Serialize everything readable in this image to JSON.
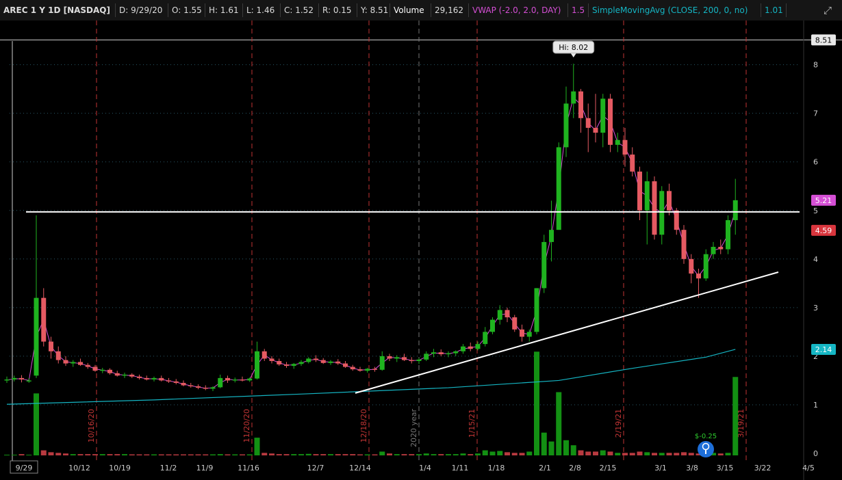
{
  "header": {
    "symbol": "AREC 1 Y 1D [NASDAQ]",
    "d": "D: 9/29/20",
    "o": "O: 1.55",
    "h": "H: 1.61",
    "l": "L: 1.46",
    "c": "C: 1.52",
    "r": "R: 0.15",
    "y": "Y: 8.51",
    "volume_label": "Volume",
    "volume_value": "29,162",
    "vwap_label": "VWAP (-2.0, 2.0, DAY)",
    "vwap_value": "1.5",
    "sma_label": "SimpleMovingAvg (CLOSE, 200, 0, no)",
    "sma_value": "1.01",
    "expand_icon": "expand-arrows-icon"
  },
  "colors": {
    "up": "#1fb31f",
    "down": "#e55a62",
    "vwap": "#d54fd5",
    "sma": "#15b6c4",
    "grid": "#2a5a6a",
    "event_line": "#c23535",
    "label_text": "#cccccc"
  },
  "price_axis": {
    "ticks": [
      "8",
      "7",
      "6",
      "5",
      "4",
      "3",
      "2",
      "1",
      "0"
    ],
    "badges": [
      {
        "text": "8.51",
        "value": 8.51,
        "bg": "#e8e8e8",
        "fg": "#000000"
      },
      {
        "text": "5.21",
        "value": 5.21,
        "bg": "#d54fd5",
        "fg": "#ffffff"
      },
      {
        "text": "4.59",
        "value": 4.59,
        "bg": "#d9363e",
        "fg": "#ffffff"
      },
      {
        "text": "2.14",
        "value": 2.14,
        "bg": "#15b6c4",
        "fg": "#ffffff"
      }
    ]
  },
  "time_axis": {
    "labels": [
      {
        "text": "9/29",
        "boxed": true
      },
      {
        "text": "10/12"
      },
      {
        "text": "10/19"
      },
      {
        "text": "11/2"
      },
      {
        "text": "11/9"
      },
      {
        "text": "11/16"
      },
      {
        "text": "12/7"
      },
      {
        "text": "12/14"
      },
      {
        "text": "1/4"
      },
      {
        "text": "1/11"
      },
      {
        "text": "1/18"
      },
      {
        "text": "2/1"
      },
      {
        "text": "2/8"
      },
      {
        "text": "2/15"
      },
      {
        "text": "3/1"
      },
      {
        "text": "3/8"
      },
      {
        "text": "3/15"
      },
      {
        "text": "3/22"
      },
      {
        "text": "4/5"
      }
    ]
  },
  "events": [
    "10/16/20",
    "11/20/20",
    "12/18/20",
    "1/15/21",
    "2/19/21",
    "3/19/21"
  ],
  "year_marker": "2020 year",
  "hi_callout": "Hi: 8.02",
  "dividend_label": "$-0.25",
  "dividend_icon": "dividend-bulb-icon",
  "annotations": {
    "resistance_level": 4.97,
    "trendline": [
      {
        "date": "12/10/20",
        "price": 1.24
      },
      {
        "date": "3/25/21",
        "price": 3.73
      }
    ]
  },
  "chart_data": {
    "type": "candlestick",
    "title": "AREC 1 Y 1D [NASDAQ]",
    "ylim": [
      0,
      8.51
    ],
    "candles": [
      [
        1.5,
        1.58,
        1.45,
        1.52
      ],
      [
        1.52,
        1.6,
        1.48,
        1.55
      ],
      [
        1.55,
        1.61,
        1.46,
        1.52
      ],
      [
        1.5,
        1.55,
        1.45,
        1.5
      ],
      [
        1.6,
        4.9,
        1.55,
        3.2
      ],
      [
        3.2,
        3.4,
        2.2,
        2.3
      ],
      [
        2.3,
        2.4,
        1.95,
        2.1
      ],
      [
        2.1,
        2.2,
        1.85,
        1.92
      ],
      [
        1.92,
        2.0,
        1.8,
        1.85
      ],
      [
        1.85,
        1.92,
        1.78,
        1.88
      ],
      [
        1.88,
        1.95,
        1.8,
        1.82
      ],
      [
        1.82,
        1.86,
        1.74,
        1.78
      ],
      [
        1.78,
        1.82,
        1.68,
        1.7
      ],
      [
        1.7,
        1.76,
        1.65,
        1.72
      ],
      [
        1.72,
        1.75,
        1.62,
        1.65
      ],
      [
        1.65,
        1.7,
        1.58,
        1.6
      ],
      [
        1.6,
        1.66,
        1.55,
        1.62
      ],
      [
        1.62,
        1.65,
        1.55,
        1.58
      ],
      [
        1.58,
        1.62,
        1.52,
        1.55
      ],
      [
        1.55,
        1.6,
        1.5,
        1.52
      ],
      [
        1.52,
        1.58,
        1.48,
        1.55
      ],
      [
        1.55,
        1.6,
        1.48,
        1.5
      ],
      [
        1.5,
        1.55,
        1.45,
        1.48
      ],
      [
        1.48,
        1.53,
        1.42,
        1.45
      ],
      [
        1.45,
        1.5,
        1.38,
        1.4
      ],
      [
        1.4,
        1.45,
        1.35,
        1.38
      ],
      [
        1.38,
        1.42,
        1.32,
        1.35
      ],
      [
        1.35,
        1.4,
        1.3,
        1.33
      ],
      [
        1.33,
        1.38,
        1.28,
        1.36
      ],
      [
        1.36,
        1.62,
        1.34,
        1.55
      ],
      [
        1.55,
        1.6,
        1.45,
        1.5
      ],
      [
        1.5,
        1.56,
        1.46,
        1.52
      ],
      [
        1.52,
        1.58,
        1.48,
        1.5
      ],
      [
        1.5,
        1.56,
        1.47,
        1.54
      ],
      [
        1.54,
        2.3,
        1.52,
        2.1
      ],
      [
        2.1,
        2.15,
        1.9,
        1.95
      ],
      [
        1.95,
        2.0,
        1.85,
        1.9
      ],
      [
        1.9,
        1.95,
        1.8,
        1.83
      ],
      [
        1.83,
        1.88,
        1.76,
        1.8
      ],
      [
        1.8,
        1.86,
        1.74,
        1.84
      ],
      [
        1.84,
        1.92,
        1.8,
        1.88
      ],
      [
        1.88,
        1.98,
        1.85,
        1.95
      ],
      [
        1.95,
        2.02,
        1.88,
        1.92
      ],
      [
        1.92,
        1.96,
        1.84,
        1.86
      ],
      [
        1.86,
        1.92,
        1.82,
        1.89
      ],
      [
        1.89,
        1.94,
        1.82,
        1.85
      ],
      [
        1.85,
        1.9,
        1.76,
        1.78
      ],
      [
        1.78,
        1.82,
        1.7,
        1.73
      ],
      [
        1.73,
        1.78,
        1.68,
        1.7
      ],
      [
        1.7,
        1.76,
        1.66,
        1.74
      ],
      [
        1.74,
        1.78,
        1.68,
        1.72
      ],
      [
        1.72,
        2.1,
        1.7,
        2.0
      ],
      [
        2.0,
        2.05,
        1.9,
        1.95
      ],
      [
        1.95,
        2.02,
        1.88,
        1.98
      ],
      [
        1.98,
        2.05,
        1.9,
        1.92
      ],
      [
        1.92,
        1.98,
        1.85,
        1.9
      ],
      [
        1.9,
        1.96,
        1.84,
        1.93
      ],
      [
        1.93,
        2.1,
        1.9,
        2.05
      ],
      [
        2.05,
        2.15,
        1.98,
        2.08
      ],
      [
        2.08,
        2.14,
        2.0,
        2.04
      ],
      [
        2.04,
        2.1,
        1.98,
        2.06
      ],
      [
        2.06,
        2.12,
        2.0,
        2.1
      ],
      [
        2.1,
        2.25,
        2.05,
        2.2
      ],
      [
        2.2,
        2.28,
        2.1,
        2.15
      ],
      [
        2.15,
        2.3,
        2.12,
        2.25
      ],
      [
        2.25,
        2.6,
        2.2,
        2.5
      ],
      [
        2.5,
        2.8,
        2.45,
        2.75
      ],
      [
        2.75,
        3.05,
        2.65,
        2.95
      ],
      [
        2.95,
        3.0,
        2.7,
        2.8
      ],
      [
        2.8,
        2.85,
        2.5,
        2.55
      ],
      [
        2.55,
        2.65,
        2.3,
        2.4
      ],
      [
        2.4,
        2.55,
        2.3,
        2.5
      ],
      [
        2.5,
        3.4,
        2.45,
        3.4
      ],
      [
        3.4,
        4.5,
        3.3,
        4.35
      ],
      [
        4.35,
        5.2,
        3.95,
        4.6
      ],
      [
        4.6,
        6.4,
        4.6,
        6.3
      ],
      [
        6.3,
        7.55,
        6.1,
        7.2
      ],
      [
        7.2,
        8.02,
        6.9,
        7.45
      ],
      [
        7.45,
        7.5,
        6.6,
        6.9
      ],
      [
        6.9,
        7.2,
        6.2,
        6.7
      ],
      [
        6.7,
        7.4,
        6.4,
        6.6
      ],
      [
        6.6,
        7.4,
        6.3,
        7.3
      ],
      [
        7.3,
        7.4,
        6.2,
        6.35
      ],
      [
        6.35,
        6.6,
        6.2,
        6.45
      ],
      [
        6.45,
        6.7,
        5.9,
        6.15
      ],
      [
        6.15,
        6.3,
        5.7,
        5.8
      ],
      [
        5.8,
        5.9,
        4.8,
        5.0
      ],
      [
        5.0,
        5.8,
        4.3,
        5.6
      ],
      [
        5.6,
        5.7,
        4.4,
        4.5
      ],
      [
        4.5,
        5.5,
        4.3,
        5.4
      ],
      [
        5.4,
        5.55,
        4.9,
        5.0
      ],
      [
        5.0,
        5.05,
        4.5,
        4.6
      ],
      [
        4.6,
        4.7,
        3.9,
        4.0
      ],
      [
        4.0,
        4.1,
        3.5,
        3.7
      ],
      [
        3.7,
        3.8,
        3.2,
        3.6
      ],
      [
        3.6,
        4.2,
        3.55,
        4.1
      ],
      [
        4.1,
        4.35,
        4.0,
        4.25
      ],
      [
        4.25,
        4.4,
        4.1,
        4.2
      ],
      [
        4.2,
        4.9,
        4.1,
        4.8
      ],
      [
        4.8,
        5.65,
        4.5,
        5.21
      ]
    ],
    "volume_bars": [
      0.05,
      0.05,
      0.1,
      0.05,
      4.9,
      0.4,
      0.25,
      0.2,
      0.15,
      0.1,
      0.1,
      0.1,
      0.1,
      0.1,
      0.1,
      0.1,
      0.1,
      0.08,
      0.08,
      0.08,
      0.08,
      0.08,
      0.08,
      0.08,
      0.08,
      0.08,
      0.08,
      0.08,
      0.08,
      0.1,
      0.08,
      0.08,
      0.08,
      0.08,
      1.4,
      0.2,
      0.15,
      0.1,
      0.1,
      0.1,
      0.1,
      0.12,
      0.1,
      0.1,
      0.1,
      0.1,
      0.1,
      0.1,
      0.08,
      0.08,
      0.08,
      0.3,
      0.15,
      0.1,
      0.1,
      0.1,
      0.1,
      0.15,
      0.1,
      0.1,
      0.1,
      0.1,
      0.15,
      0.1,
      0.15,
      0.4,
      0.3,
      0.35,
      0.25,
      0.2,
      0.2,
      0.3,
      8.2,
      1.8,
      1.1,
      5.0,
      1.2,
      0.8,
      0.4,
      0.3,
      0.3,
      0.4,
      0.3,
      0.2,
      0.2,
      0.2,
      0.3,
      0.25,
      0.2,
      0.2,
      0.2,
      0.2,
      0.25,
      0.2,
      0.15,
      0.15,
      0.2,
      0.15,
      0.2,
      6.2
    ],
    "vwap_line": [],
    "sma_line": [
      [
        0,
        1.01
      ],
      [
        20,
        1.1
      ],
      [
        40,
        1.22
      ],
      [
        60,
        1.35
      ],
      [
        75,
        1.5
      ],
      [
        85,
        1.75
      ],
      [
        95,
        1.98
      ],
      [
        99,
        2.14
      ]
    ]
  }
}
